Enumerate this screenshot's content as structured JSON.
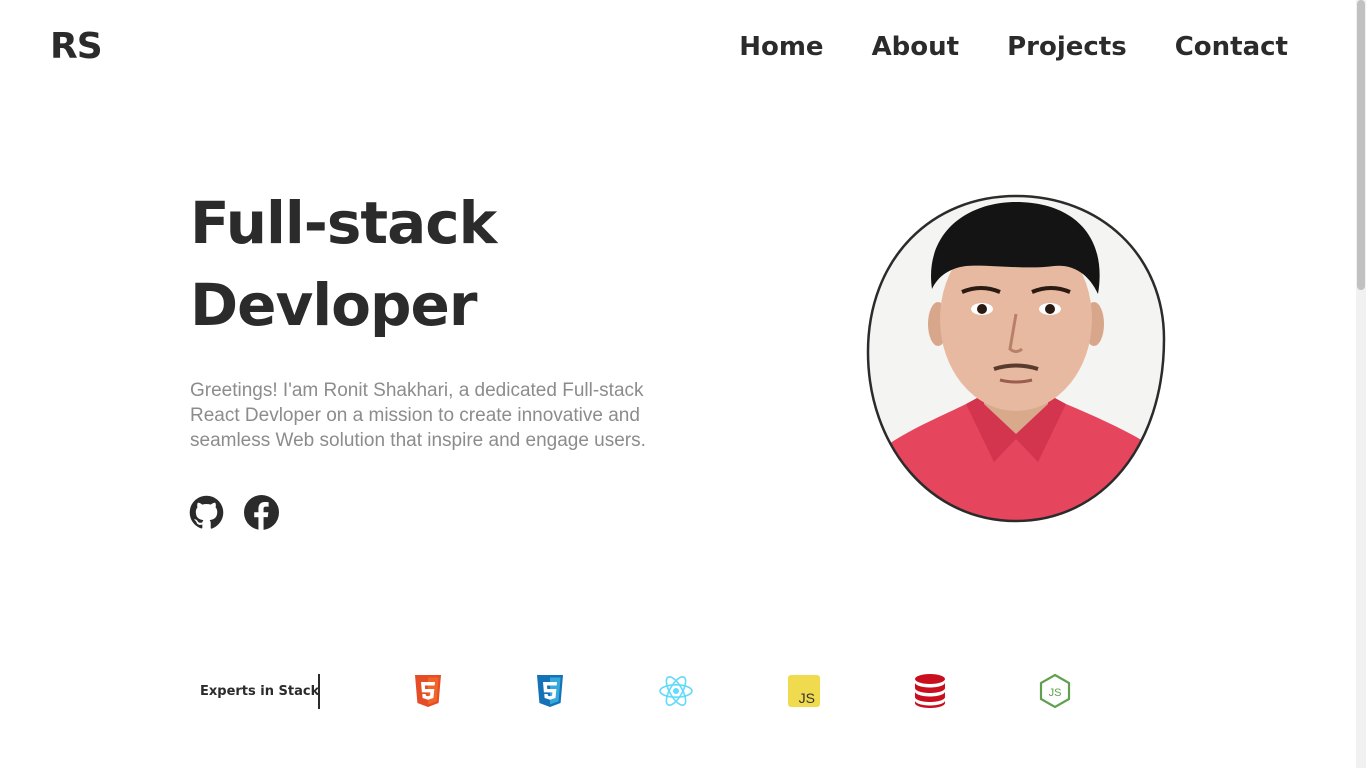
{
  "header": {
    "logo": "RS",
    "nav": [
      {
        "label": "Home"
      },
      {
        "label": "About"
      },
      {
        "label": "Projects"
      },
      {
        "label": "Contact"
      }
    ]
  },
  "hero": {
    "title_line1": "Full-stack",
    "title_line2": "Devloper",
    "description": "Greetings! I'am Ronit Shakhari, a dedicated Full-stack React Devloper on a mission to create innovative and seamless Web solution that inspire and engage users.",
    "socials": [
      {
        "icon": "github-icon"
      },
      {
        "icon": "facebook-icon"
      }
    ]
  },
  "stack": {
    "label": "Experts in Stack",
    "icons": [
      {
        "name": "html5-icon",
        "color": "#e44d26"
      },
      {
        "name": "css3-icon",
        "color": "#1572b6"
      },
      {
        "name": "react-icon",
        "color": "#61dafb"
      },
      {
        "name": "javascript-icon",
        "color": "#f0db4f"
      },
      {
        "name": "database-icon",
        "color": "#c90f1e"
      },
      {
        "name": "nodejs-icon",
        "color": "#5fa04e"
      }
    ]
  },
  "colors": {
    "text": "#2b2b2b",
    "muted": "#8c8c8c",
    "shirt": "#e5455d"
  }
}
